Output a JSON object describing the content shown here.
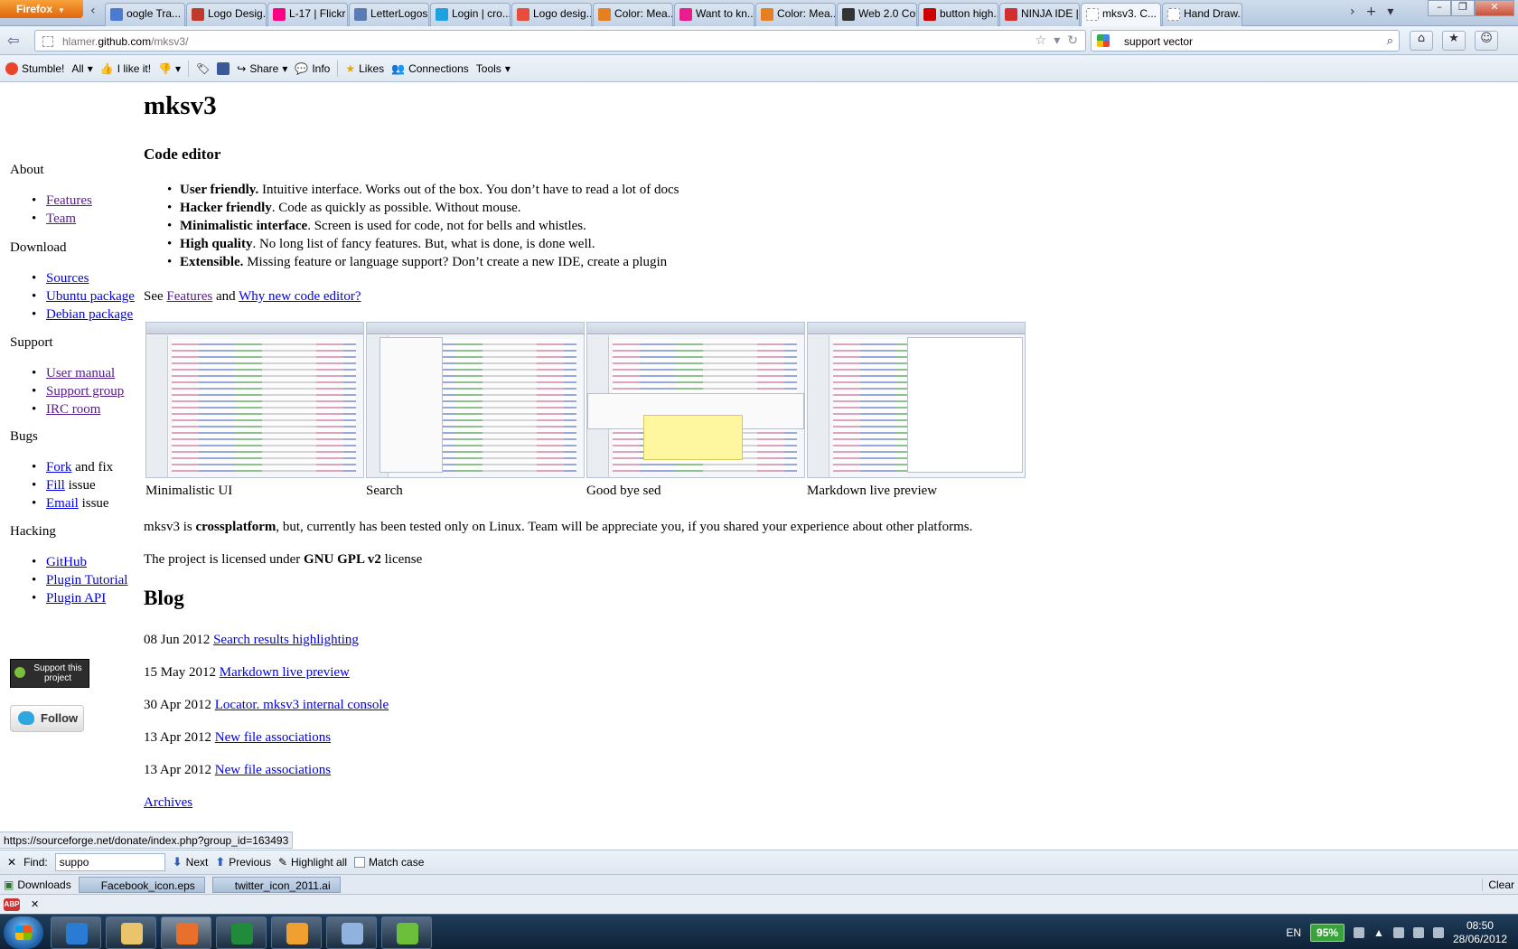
{
  "browser": {
    "menu_label": "Firefox",
    "tabs": [
      {
        "title": "oogle Tra...",
        "color": "#4a7bd0"
      },
      {
        "title": "Logo Desig...",
        "color": "#c0392b"
      },
      {
        "title": "L-17 | Flickr ...",
        "color": "#ff0084"
      },
      {
        "title": "LetterLogos...",
        "color": "#5b7bb5"
      },
      {
        "title": "Login | cro...",
        "color": "#1da1e0"
      },
      {
        "title": "Logo desig...",
        "color": "#e74c3c"
      },
      {
        "title": "Color: Mea...",
        "color": "#e67e22"
      },
      {
        "title": "Want to kn...",
        "color": "#e91e8c"
      },
      {
        "title": "Color: Mea...",
        "color": "#e67e22"
      },
      {
        "title": "Web 2.0 Col...",
        "color": "#333333"
      },
      {
        "title": "button high...",
        "color": "#cc0000"
      },
      {
        "title": "NINJA IDE | ...",
        "color": "#d32f2f"
      },
      {
        "title": "mksv3. C...",
        "color": "#ffffff",
        "active": true
      },
      {
        "title": "Hand Draw...",
        "color": "#ffffff"
      }
    ],
    "url": {
      "pre": "hlamer.",
      "host": "github.com",
      "path": "/mksv3/"
    },
    "search_value": "support vector"
  },
  "toolbar": {
    "stumble": "Stumble!",
    "all": "All",
    "like": "I like it!",
    "share": "Share",
    "info": "Info",
    "likes": "Likes",
    "connections": "Connections",
    "tools": "Tools"
  },
  "sidebar": {
    "sections": [
      {
        "title": "About",
        "links": [
          {
            "text": "Features",
            "visited": true
          },
          {
            "text": "Team",
            "visited": true
          }
        ]
      },
      {
        "title": "Download",
        "links": [
          {
            "text": "Sources"
          },
          {
            "text": "Ubuntu package"
          },
          {
            "text": "Debian package"
          }
        ]
      },
      {
        "title": "Support",
        "links": [
          {
            "text": "User manual",
            "visited": true
          },
          {
            "text": "Support group",
            "visited": true
          },
          {
            "text": "IRC room",
            "visited": true
          }
        ]
      },
      {
        "title": "Bugs",
        "links": [
          {
            "text": "Fork",
            "suffix": " and fix"
          },
          {
            "text": "Fill",
            "suffix": " issue"
          },
          {
            "text": "Email",
            "suffix": " issue"
          }
        ]
      },
      {
        "title": "Hacking",
        "links": [
          {
            "text": "GitHub"
          },
          {
            "text": "Plugin Tutorial"
          },
          {
            "text": "Plugin API"
          }
        ]
      }
    ],
    "donate_label": "Support this project",
    "follow_label": "Follow"
  },
  "main": {
    "title": "mksv3",
    "subtitle": "Code editor",
    "features": [
      {
        "bold": "User friendly.",
        "rest": " Intuitive interface. Works out of the box. You don’t have to read a lot of docs"
      },
      {
        "bold": "Hacker friendly",
        "rest": ". Code as quickly as possible. Without mouse."
      },
      {
        "bold": "Minimalistic interface",
        "rest": ". Screen is used for code, not for bells and whistles."
      },
      {
        "bold": "High quality",
        "rest": ". No long list of fancy features. But, what is done, is done well."
      },
      {
        "bold": "Extensible.",
        "rest": " Missing feature or language support? Don’t create a new IDE, create a plugin"
      }
    ],
    "see": {
      "prefix": "See ",
      "link1": "Features",
      "mid": " and ",
      "link2": "Why new code editor?"
    },
    "screenshots": [
      {
        "caption": "Minimalistic UI"
      },
      {
        "caption": "Search"
      },
      {
        "caption": "Good bye sed"
      },
      {
        "caption": "Markdown live preview"
      }
    ],
    "crossplatform": {
      "pre": "mksv3 is ",
      "bold": "crossplatform",
      "post": ", but, currently has been tested only on Linux. Team will be appreciate you, if you shared your experience about other platforms."
    },
    "license": {
      "pre": "The project is licensed under ",
      "bold": "GNU GPL v2",
      "post": " license"
    },
    "blog_title": "Blog",
    "posts": [
      {
        "date": "08 Jun 2012 ",
        "title": "Search results highlighting"
      },
      {
        "date": "15 May 2012 ",
        "title": "Markdown live preview"
      },
      {
        "date": "30 Apr 2012 ",
        "title": "Locator. mksv3 internal console"
      },
      {
        "date": "13 Apr 2012 ",
        "title": "New file associations"
      },
      {
        "date": "13 Apr 2012 ",
        "title": "New file associations"
      }
    ],
    "archives": "Archives"
  },
  "status_url": "https://sourceforge.net/donate/index.php?group_id=163493",
  "findbar": {
    "label": "Find:",
    "value": "suppo",
    "next": "Next",
    "previous": "Previous",
    "highlight": "Highlight all",
    "match_case": "Match case"
  },
  "downloads": {
    "label": "Downloads",
    "files": [
      "Facebook_icon.eps",
      "twitter_icon_2011.ai"
    ],
    "clear": "Clear"
  },
  "addon": {
    "abp": "ABP"
  },
  "taskbar": {
    "lang": "EN",
    "battery": "95%",
    "time": "08:50",
    "date": "28/06/2012",
    "apps": [
      {
        "name": "ie",
        "color": "#2a7bd4"
      },
      {
        "name": "explorer",
        "color": "#e9c46a"
      },
      {
        "name": "firefox",
        "color": "#e8702a",
        "active": true
      },
      {
        "name": "excel",
        "color": "#1f8b3b"
      },
      {
        "name": "mail",
        "color": "#f0a030"
      },
      {
        "name": "network",
        "color": "#8fb3de"
      },
      {
        "name": "app",
        "color": "#6bbf3a"
      }
    ]
  }
}
